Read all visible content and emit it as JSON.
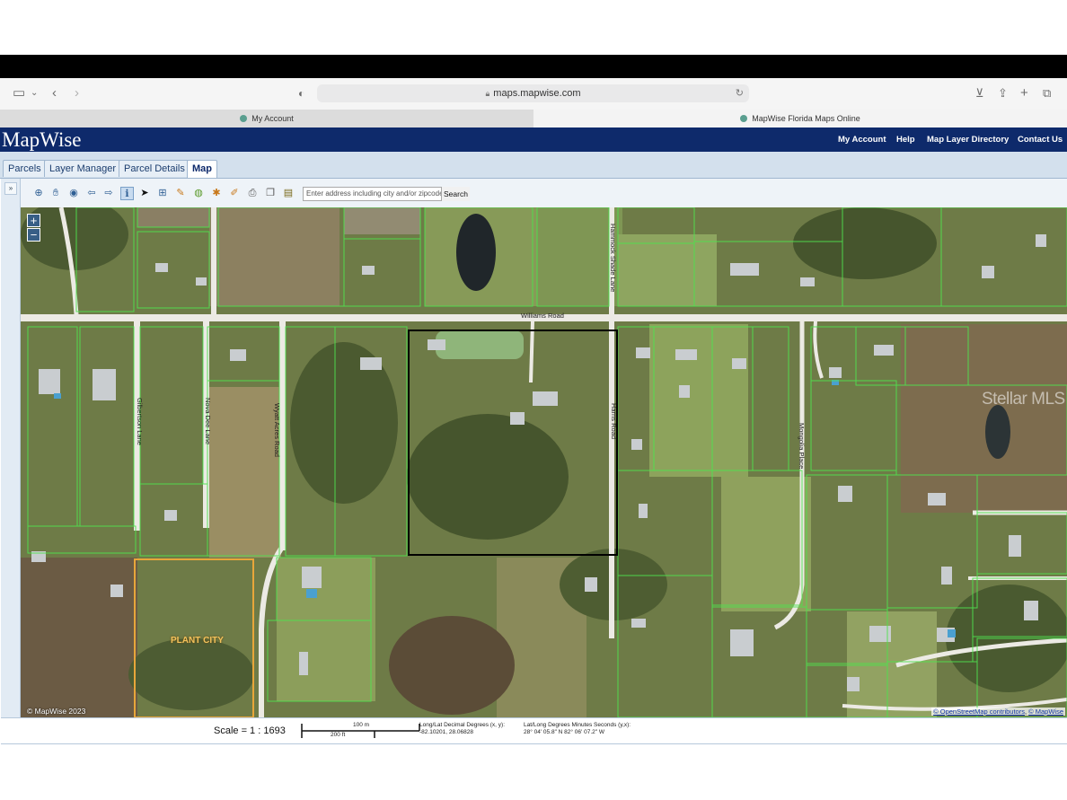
{
  "browser": {
    "url": "maps.mapwise.com",
    "tabs": [
      {
        "label": "My Account",
        "active": false
      },
      {
        "label": "MapWise Florida Maps Online",
        "active": true
      }
    ]
  },
  "app": {
    "logo": "MapWise",
    "nav": [
      "My Account",
      "Help",
      "Map Layer Directory",
      "Contact Us"
    ],
    "tabs": [
      "Parcels",
      "Layer Manager",
      "Parcel Details",
      "Map"
    ],
    "active_tab": "Map"
  },
  "toolbar": {
    "tools": [
      "zoom-in-icon",
      "pan-hand-icon",
      "center-icon",
      "back-arrow-icon",
      "forward-arrow-icon",
      "identify-icon",
      "select-arrow-icon",
      "zoom-box-icon",
      "measure-icon",
      "buffer-icon",
      "layers-icon",
      "draw-icon",
      "edit-icon",
      "print-icon",
      "copy-icon",
      "legend-icon"
    ],
    "search_placeholder": "Enter address including city and/or zipcode.",
    "search_label": "Search"
  },
  "map": {
    "zoom_in": "+",
    "zoom_out": "−",
    "road_labels": {
      "williams": "Williams Road",
      "hammock": "Hammock Shade Lane",
      "gilbertson": "Gilbertson Lane",
      "nova_dee": "Nova Dee Lane",
      "wyatt_acres": "Wyatt Acres Road",
      "harris": "Harris Road",
      "mongolia": "Mongolia Place"
    },
    "area_label": "PLANT CITY",
    "watermark": "Stellar MLS",
    "copyright": "© MapWise 2023",
    "attribution": [
      "© OpenStreetMap contributors",
      "© MapWise"
    ],
    "colors": {
      "parcel_lines": "#4ee34e",
      "selected_parcel": "#000000",
      "city_boundary": "#e8a63a"
    }
  },
  "status": {
    "scale": "Scale = 1 : 1693",
    "scalebar_top": "100 m",
    "scalebar_bottom": "200 ft",
    "decimal_label": "Long/Lat Decimal Degrees (x, y):",
    "decimal_value": "-82.10201, 28.06828",
    "dms_label": "Lat/Long Degrees Minutes Seconds (y,x):",
    "dms_value": "28° 04' 05.8\" N 82° 06' 07.2\" W"
  }
}
